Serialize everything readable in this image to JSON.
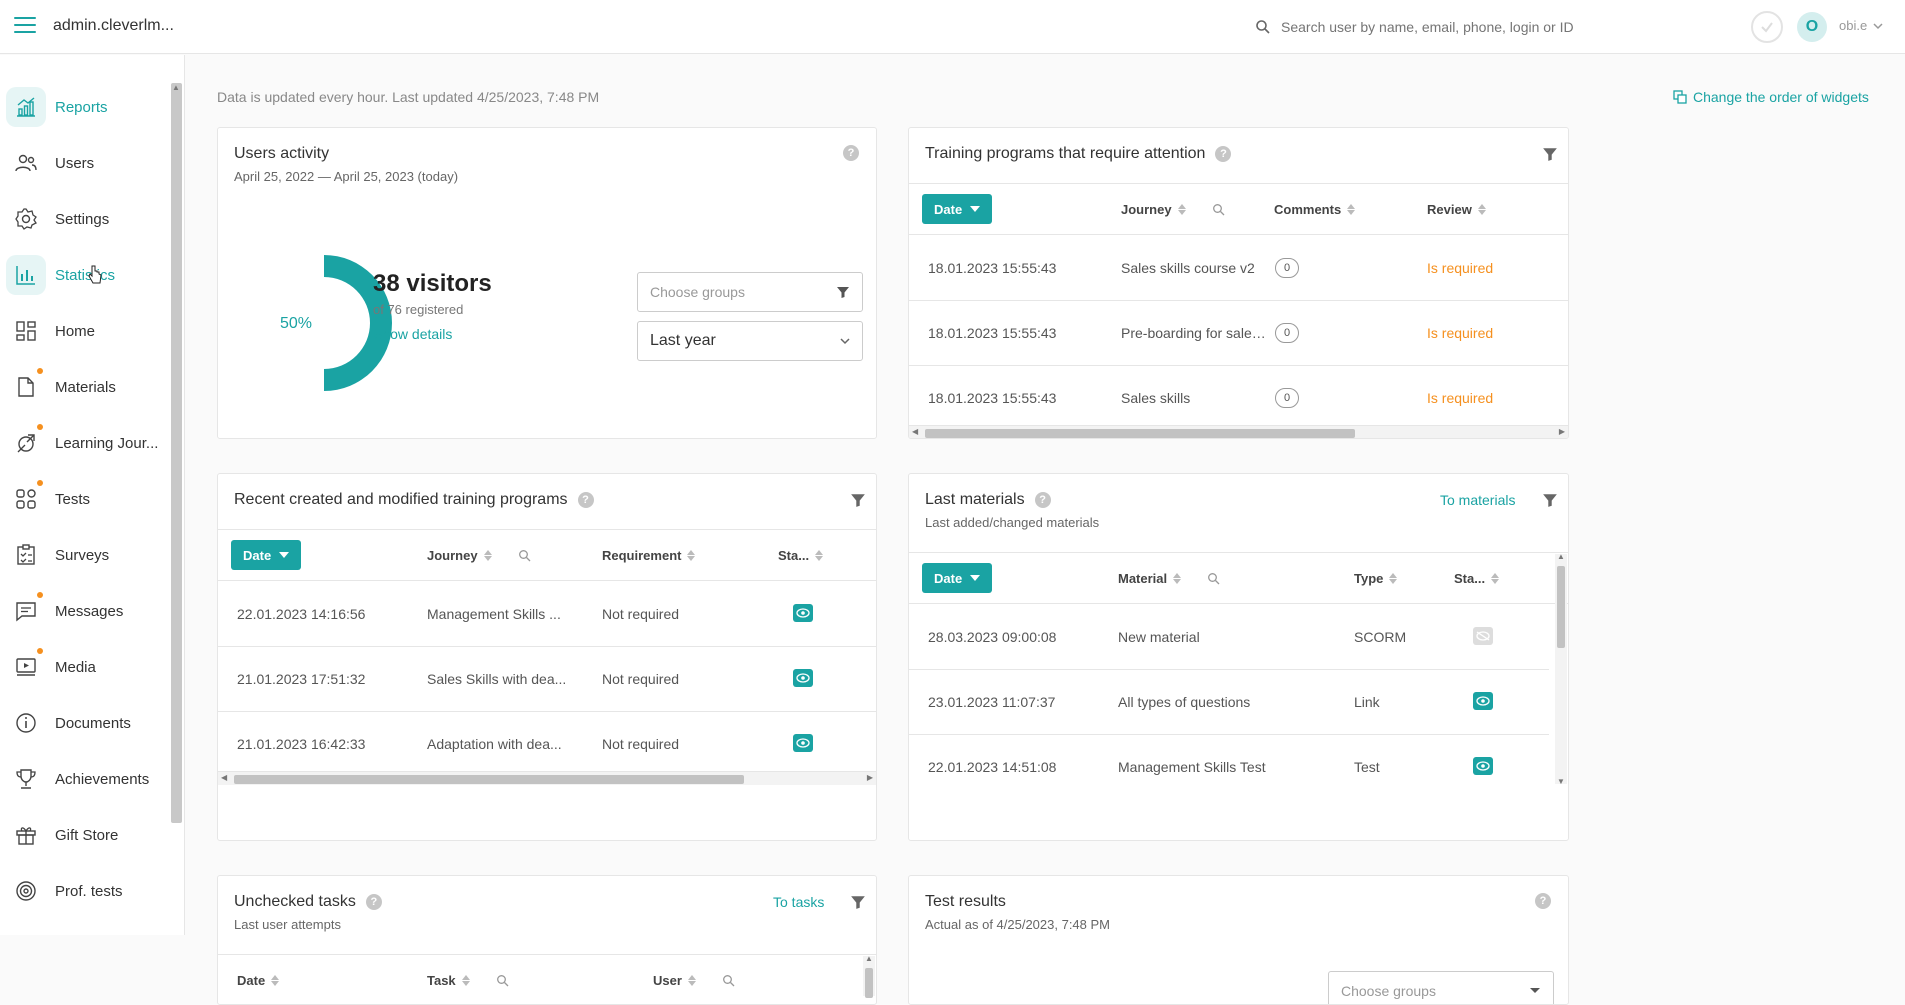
{
  "topbar": {
    "app_title": "admin.cleverlm...",
    "search_placeholder": "Search user by name, email, phone, login or ID",
    "avatar_letter": "O",
    "username": "obi.e"
  },
  "sidebar": {
    "items": [
      {
        "label": "Reports",
        "icon": "reports-icon",
        "active": true,
        "dot": false
      },
      {
        "label": "Users",
        "icon": "users-icon",
        "active": false,
        "dot": false
      },
      {
        "label": "Settings",
        "icon": "gear-icon",
        "active": false,
        "dot": false
      },
      {
        "label": "Statistics",
        "icon": "bar-chart-icon",
        "active": true,
        "dot": false
      },
      {
        "label": "Home",
        "icon": "dashboard-icon",
        "active": false,
        "dot": false
      },
      {
        "label": "Materials",
        "icon": "document-icon",
        "active": false,
        "dot": true
      },
      {
        "label": "Learning Jour...",
        "icon": "journey-icon",
        "active": false,
        "dot": true
      },
      {
        "label": "Tests",
        "icon": "tests-icon",
        "active": false,
        "dot": true
      },
      {
        "label": "Surveys",
        "icon": "clipboard-icon",
        "active": false,
        "dot": false
      },
      {
        "label": "Messages",
        "icon": "chat-icon",
        "active": false,
        "dot": true
      },
      {
        "label": "Media",
        "icon": "media-icon",
        "active": false,
        "dot": true
      },
      {
        "label": "Documents",
        "icon": "info-icon",
        "active": false,
        "dot": false
      },
      {
        "label": "Achievements",
        "icon": "trophy-icon",
        "active": false,
        "dot": false
      },
      {
        "label": "Gift Store",
        "icon": "gift-icon",
        "active": false,
        "dot": false
      },
      {
        "label": "Prof. tests",
        "icon": "target-icon",
        "active": false,
        "dot": false
      }
    ]
  },
  "main": {
    "updated_text": "Data is updated every hour. Last updated 4/25/2023, 7:48 PM",
    "change_order": "Change the order of widgets"
  },
  "users_activity": {
    "title": "Users activity",
    "range": "April 25, 2022 — April 25, 2023 (today)",
    "percent_label": "50%",
    "percent_value": 0.5,
    "visitors": "38 visitors",
    "registered": "of 76 registered",
    "show_details": "Show details",
    "groups_placeholder": "Choose groups",
    "period": "Last year"
  },
  "training_attention": {
    "title": "Training programs that require attention",
    "columns": [
      "Date",
      "Journey",
      "Comments",
      "Review"
    ],
    "rows": [
      {
        "date": "18.01.2023 15:55:43",
        "journey": "Sales skills course v2",
        "comments": "0",
        "review": "Is required"
      },
      {
        "date": "18.01.2023 15:55:43",
        "journey": "Pre-boarding for sales ...",
        "comments": "0",
        "review": "Is required"
      },
      {
        "date": "18.01.2023 15:55:43",
        "journey": "Sales skills",
        "comments": "0",
        "review": "Is required"
      }
    ]
  },
  "recent_programs": {
    "title": "Recent created and modified training programs",
    "columns": [
      "Date",
      "Journey",
      "Requirement",
      "Sta..."
    ],
    "rows": [
      {
        "date": "22.01.2023 14:16:56",
        "journey": "Management Skills ...",
        "requirement": "Not required"
      },
      {
        "date": "21.01.2023 17:51:32",
        "journey": "Sales Skills with dea...",
        "requirement": "Not required"
      },
      {
        "date": "21.01.2023 16:42:33",
        "journey": "Adaptation with dea...",
        "requirement": "Not required"
      }
    ]
  },
  "last_materials": {
    "title": "Last materials",
    "subtitle": "Last added/changed materials",
    "to_materials": "To materials",
    "columns": [
      "Date",
      "Material",
      "Type",
      "Sta..."
    ],
    "rows": [
      {
        "date": "28.03.2023 09:00:08",
        "material": "New material",
        "type": "SCORM",
        "visible": false
      },
      {
        "date": "23.01.2023 11:07:37",
        "material": "All types of questions",
        "type": "Link",
        "visible": true
      },
      {
        "date": "22.01.2023 14:51:08",
        "material": "Management Skills Test",
        "type": "Test",
        "visible": true
      }
    ]
  },
  "unchecked_tasks": {
    "title": "Unchecked tasks",
    "subtitle": "Last user attempts",
    "to_tasks": "To tasks",
    "columns": [
      "Date",
      "Task",
      "User"
    ]
  },
  "test_results": {
    "title": "Test results",
    "subtitle": "Actual as of 4/25/2023, 7:48 PM",
    "groups_placeholder": "Choose groups"
  },
  "colors": {
    "accent": "#1aa3a3",
    "warning": "#f5901f",
    "dot": "#f5901f"
  }
}
